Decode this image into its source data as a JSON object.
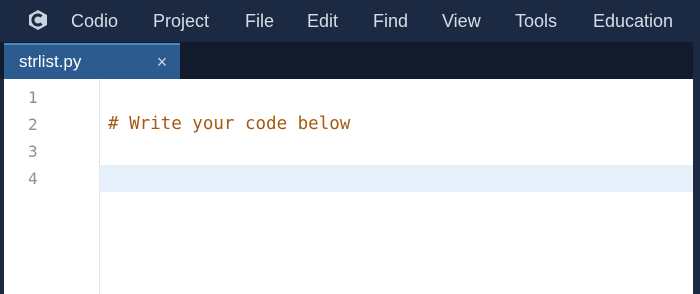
{
  "menubar": {
    "logo": "codio-logo-icon",
    "items": [
      "Codio",
      "Project",
      "File",
      "Edit",
      "Find",
      "View",
      "Tools",
      "Education"
    ]
  },
  "tabs": [
    {
      "label": "strlist.py",
      "close": "×",
      "active": true
    }
  ],
  "editor": {
    "line_numbers": [
      "1",
      "2",
      "3",
      "4"
    ],
    "lines": [
      "",
      "# Write your code below",
      "",
      ""
    ],
    "active_line": 4
  },
  "colors": {
    "menubar_bg": "#1b2a42",
    "tab_active_bg": "#2b5b8f",
    "comment": "#a35a12",
    "active_line_bg": "#e6f0fb"
  }
}
